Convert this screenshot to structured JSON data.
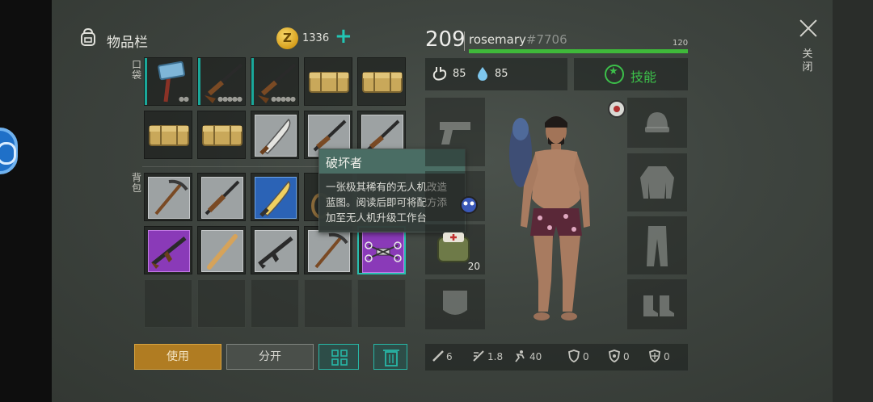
{
  "inventory": {
    "title": "物品栏",
    "coins": "1336",
    "add_label": "+",
    "pockets_label": "口袋",
    "backpack_label": "背包"
  },
  "tooltip": {
    "title": "破坏者",
    "desc_line1": "一张极其稀有的无人机改造",
    "desc_line2": "蓝图。阅读后即可将配方添",
    "desc_line3": "加至无人机升级工作台"
  },
  "actions": {
    "use_label": "使用",
    "split_label": "分开"
  },
  "player": {
    "level": "209",
    "name": "rosemary",
    "tag": "#7706",
    "xp_max": "120",
    "xp_fraction": 1.0,
    "food": "85",
    "water": "85",
    "skills_label": "技能"
  },
  "equipment": {
    "bag_count": "20"
  },
  "stats": {
    "melee": "6",
    "speed": "1.8",
    "run": "40",
    "armor": "0",
    "radiation": "0",
    "cold": "0"
  },
  "window": {
    "close_label": "关闭"
  },
  "colors": {
    "accent_teal": "#27b7a7",
    "xp_green": "#3fb93a",
    "use_gold": "#b07c22",
    "rare_purple": "#8a3ab8",
    "blueprint_blue": "#2b63b6"
  }
}
